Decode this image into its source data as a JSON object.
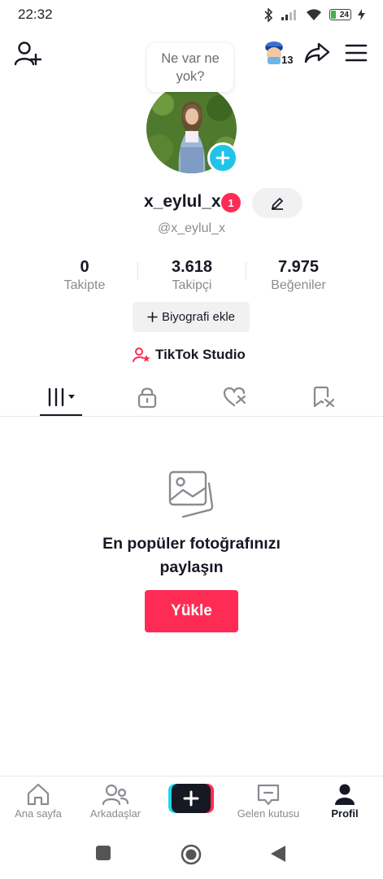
{
  "status_bar": {
    "time": "22:32",
    "battery_level": "24"
  },
  "header": {
    "prompt_bubble": "Ne var ne yok?",
    "visitor_count": "13"
  },
  "profile": {
    "username": "x_eylul_x",
    "notification_badge": "1",
    "handle": "@x_eylul_x"
  },
  "stats": [
    {
      "value": "0",
      "label": "Takipte"
    },
    {
      "value": "3.618",
      "label": "Takipçi"
    },
    {
      "value": "7.975",
      "label": "Beğeniler"
    }
  ],
  "actions": {
    "bio_button": "Biyografi ekle",
    "studio_link": "TikTok Studio"
  },
  "tabs": [
    {
      "icon": "grid-videos-icon",
      "active": true
    },
    {
      "icon": "lock-icon",
      "active": false
    },
    {
      "icon": "liked-heart-icon",
      "active": false
    },
    {
      "icon": "saved-bookmark-icon",
      "active": false
    }
  ],
  "empty_state": {
    "title_line1": "En popüler fotoğrafınızı",
    "title_line2": "paylaşın",
    "button": "Yükle"
  },
  "bottom_nav": [
    {
      "label": "Ana sayfa",
      "icon": "home-icon"
    },
    {
      "label": "Arkadaşlar",
      "icon": "friends-icon"
    },
    {
      "label": "",
      "icon": "create-plus-icon"
    },
    {
      "label": "Gelen kutusu",
      "icon": "inbox-icon"
    },
    {
      "label": "Profil",
      "icon": "profile-icon",
      "active": true
    }
  ],
  "colors": {
    "accent": "#fe2c55",
    "cyan": "#20c4e8",
    "text": "#161823",
    "muted": "#8a8b91"
  }
}
